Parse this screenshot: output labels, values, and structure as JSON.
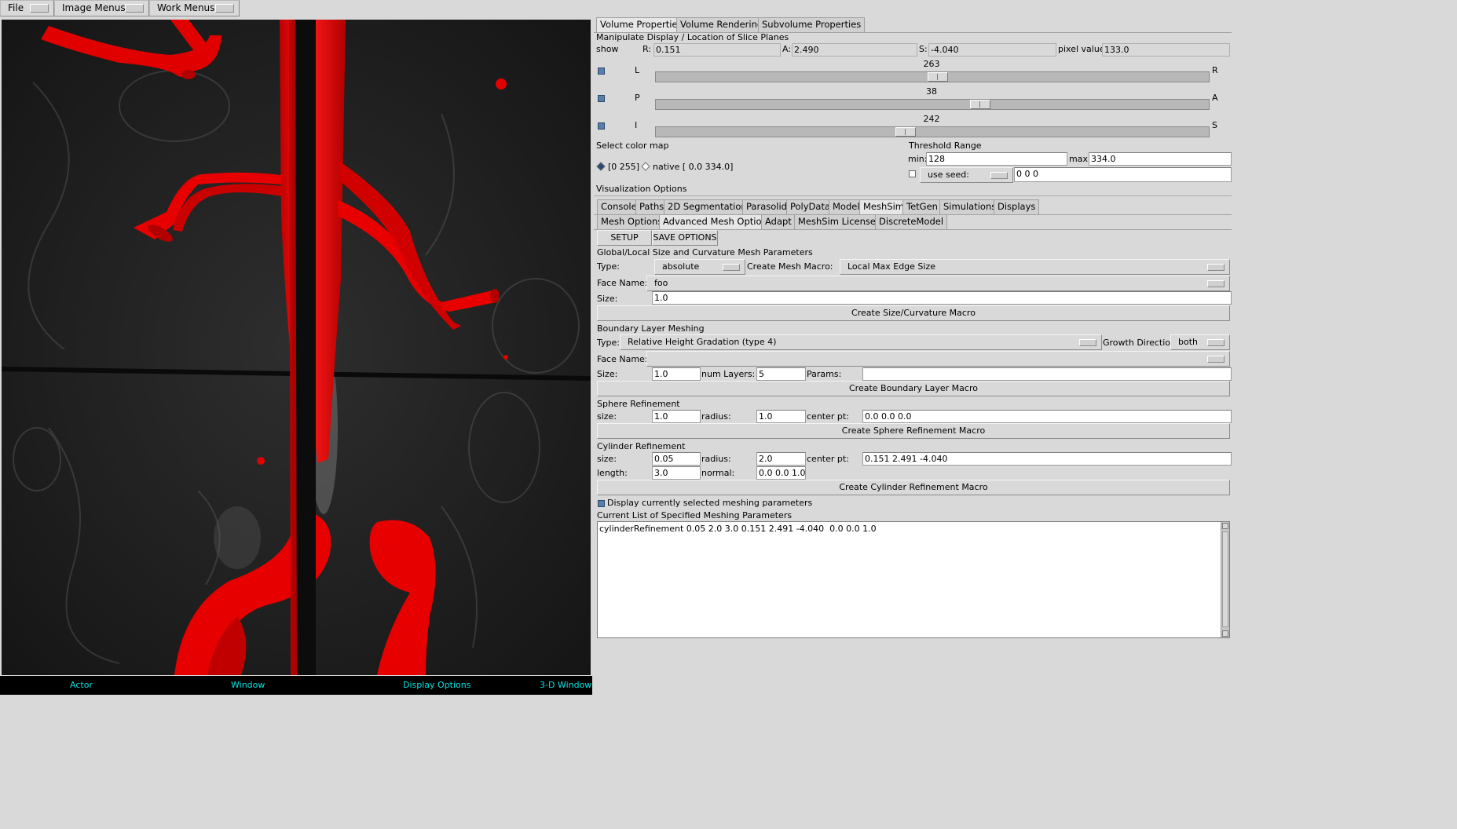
{
  "menubar": {
    "items": [
      {
        "label": "File"
      },
      {
        "label": "Image Menus"
      },
      {
        "label": "Work Menus"
      }
    ]
  },
  "viewer": {
    "footer": {
      "actor": "Actor",
      "window": "Window",
      "display_options": "Display Options",
      "window_3d": "3-D Window"
    },
    "colors": {
      "vessel": "#ee0000",
      "background": "#1a1a1a",
      "overlay_text": "#00e0e0"
    }
  },
  "volume_tabs": [
    "Volume Properties",
    "Volume Rendering",
    "Subvolume Properties"
  ],
  "slice": {
    "heading": "Manipulate Display / Location of Slice Planes",
    "show_label": "show",
    "r_label": "R:",
    "r_value": "0.151",
    "a_label": "A:",
    "a_value": "2.490",
    "s_label": "S:",
    "s_value": "-4.040",
    "pixel_label": "pixel value:",
    "pixel_value": "133.0",
    "sliders": [
      {
        "left": "L",
        "right": "R",
        "value": "263",
        "level": 0.51
      },
      {
        "left": "P",
        "right": "A",
        "value": "38",
        "level": 0.59
      },
      {
        "left": "I",
        "right": "S",
        "value": "242",
        "level": 0.45
      }
    ]
  },
  "colormap": {
    "label": "Select color map",
    "option1": "[0 255]",
    "option2": "native [ 0.0 334.0]"
  },
  "threshold": {
    "label": "Threshold Range",
    "min_label": "min:",
    "min_value": "128",
    "max_label": "max:",
    "max_value": "334.0",
    "use_seed": "use seed:",
    "seed_value": "0 0 0"
  },
  "viz_label": "Visualization Options",
  "viz_tabs": [
    "Console",
    "Paths",
    "2D Segmentation",
    "Parasolid",
    "PolyData",
    "Model",
    "MeshSim",
    "TetGen",
    "Simulations",
    "Displays"
  ],
  "mesh_tabs": [
    "Mesh Options",
    "Advanced Mesh Options",
    "Adapt",
    "MeshSim Licenses",
    "DiscreteModel"
  ],
  "setup_btn": "SETUP",
  "save_btn": "SAVE OPTIONS",
  "global": {
    "heading": "Global/Local Size and Curvature Mesh Parameters",
    "type_label": "Type:",
    "type_value": "absolute",
    "macro_label": "Create Mesh Macro:",
    "macro_value": "Local Max Edge Size",
    "face_label": "Face Name:",
    "face_value": "foo",
    "size_label": "Size:",
    "size_value": "1.0",
    "create_btn": "Create Size/Curvature Macro"
  },
  "boundary": {
    "heading": "Boundary Layer Meshing",
    "type_label": "Type:",
    "type_value": "Relative Height Gradation (type 4)",
    "growth_label": "Growth Direction:",
    "growth_value": "both",
    "face_label": "Face Name:",
    "size_label": "Size:",
    "size_value": "1.0",
    "layers_label": "num Layers:",
    "layers_value": "5",
    "params_label": "Params:",
    "create_btn": "Create Boundary Layer Macro"
  },
  "sphere": {
    "heading": "Sphere Refinement",
    "size_label": "size:",
    "size_value": "1.0",
    "radius_label": "radius:",
    "radius_value": "1.0",
    "center_label": "center pt:",
    "center_value": "0.0 0.0 0.0",
    "create_btn": "Create Sphere Refinement Macro"
  },
  "cylinder": {
    "heading": "Cylinder Refinement",
    "size_label": "size:",
    "size_value": "0.05",
    "radius_label": "radius:",
    "radius_value": "2.0",
    "center_label": "center pt:",
    "center_value": "0.151 2.491 -4.040",
    "length_label": "length:",
    "length_value": "3.0",
    "normal_label": "normal:",
    "normal_value": "0.0 0.0 1.0",
    "create_btn": "Create Cylinder Refinement Macro"
  },
  "display_params": "Display currently selected meshing parameters",
  "current_list": {
    "label": "Current List of Specified Meshing Parameters",
    "items": [
      "cylinderRefinement 0.05 2.0 3.0 0.151 2.491 -4.040  0.0 0.0 1.0"
    ]
  }
}
